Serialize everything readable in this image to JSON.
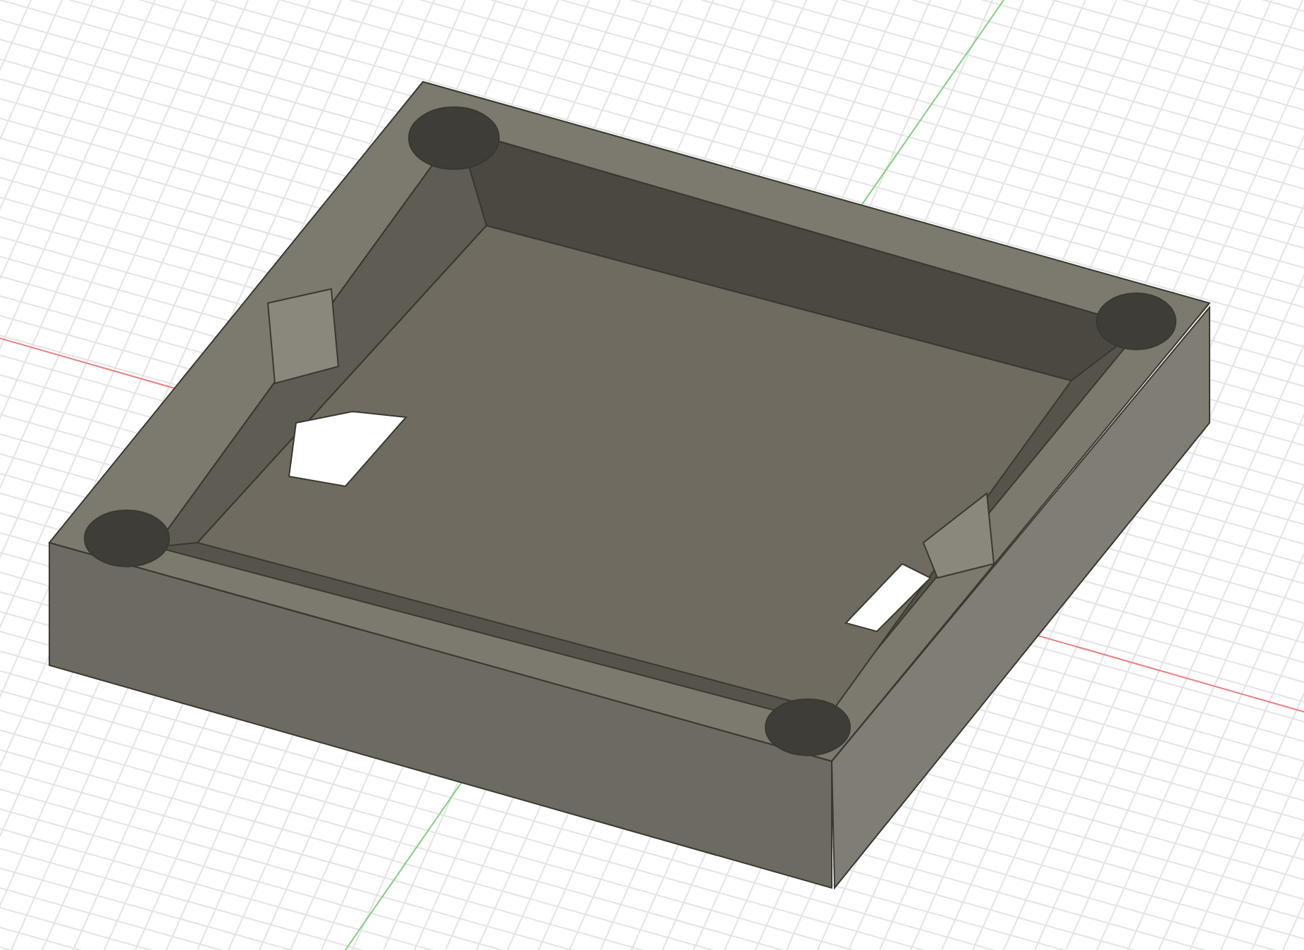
{
  "viewport": {
    "kind": "tray"
  }
}
